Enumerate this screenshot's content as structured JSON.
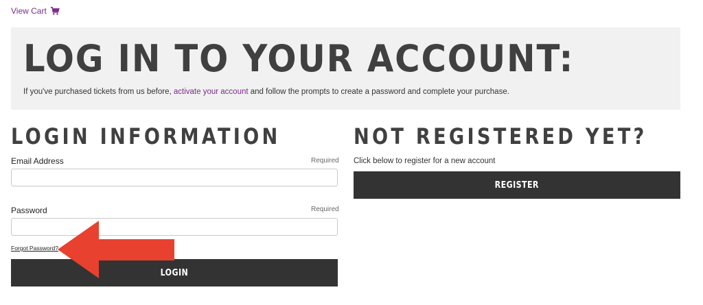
{
  "topbar": {
    "view_cart": "View Cart",
    "cart_icon": "shopping-cart-icon"
  },
  "hero": {
    "title": "LOG IN TO YOUR ACCOUNT:",
    "text_before": "If you've purchased tickets from us before, ",
    "link": "activate your account",
    "text_after": " and follow the prompts to create a password and complete your purchase."
  },
  "login": {
    "title": "LOGIN INFORMATION",
    "email_label": "Email Address",
    "email_required": "Required",
    "email_value": "",
    "password_label": "Password",
    "password_required": "Required",
    "password_value": "",
    "forgot": "Forgot Password?",
    "button": "LOGIN"
  },
  "register": {
    "title": "NOT REGISTERED YET?",
    "text": "Click below to register for a new account",
    "button": "REGISTER"
  },
  "colors": {
    "accent": "#7a2a8a",
    "button_bg": "#333333",
    "hero_bg": "#f1f1f1",
    "arrow": "#e8412f"
  }
}
